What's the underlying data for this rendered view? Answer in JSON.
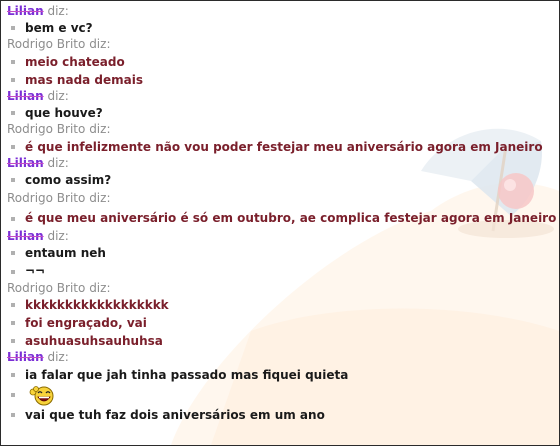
{
  "messages": [
    {
      "sender": "Lilian",
      "says": "diz:",
      "lines": [
        "bem e vc?"
      ]
    },
    {
      "sender": "Rodrigo Brito",
      "says": "diz:",
      "lines": [
        "meio chateado",
        "mas nada demais"
      ]
    },
    {
      "sender": "Lilian",
      "says": "diz:",
      "lines": [
        "que houve?"
      ]
    },
    {
      "sender": "Rodrigo Brito",
      "says": "diz:",
      "lines": [
        "é que infelizmente não vou poder festejar meu aniversário agora em Janeiro"
      ]
    },
    {
      "sender": "Lilian",
      "says": "diz:",
      "lines": [
        "como assim?"
      ]
    },
    {
      "sender": "Rodrigo Brito",
      "says": "diz:",
      "lines": [
        "é que meu aniversário é só em outubro, ae complica festejar agora em Janeiro"
      ],
      "emoticon": "thinking-emoticon"
    },
    {
      "sender": "Lilian",
      "says": "diz:",
      "lines": [
        "entaum neh",
        "¬¬"
      ]
    },
    {
      "sender": "Rodrigo Brito",
      "says": "diz:",
      "lines": [
        "kkkkkkkkkkkkkkkkkk",
        "foi engraçado, vai",
        "asuhuasuhsauhuhsa"
      ]
    },
    {
      "sender": "Lilian",
      "says": "diz:",
      "lines": [
        "ia falar que jah tinha passado mas fiquei quieta",
        "",
        "vai que tuh faz dois aniversários em um ano"
      ],
      "emoticon": "laughing-emoticon"
    }
  ],
  "colors": {
    "lilian_name": "#7b2fd6",
    "rodrigo_text": "#7a1f2b",
    "lilian_text": "#1a1a1a",
    "sender_gray": "#8d8d8d",
    "bullet": "#b0b0b0"
  }
}
